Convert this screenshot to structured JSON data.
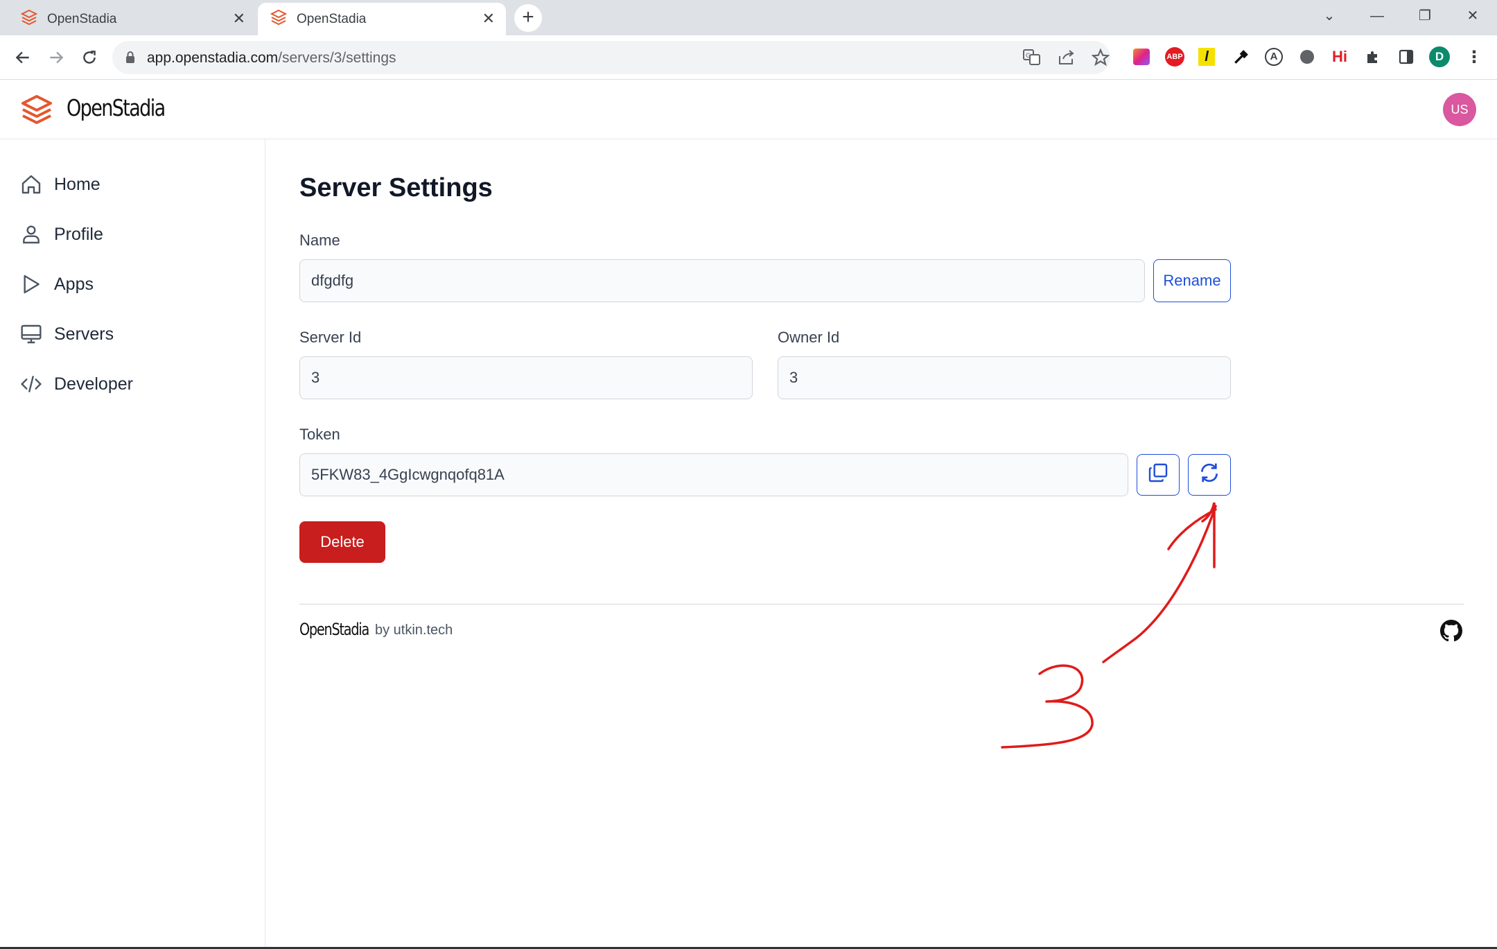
{
  "browser": {
    "tabs": [
      {
        "title": "OpenStadia",
        "active": false
      },
      {
        "title": "OpenStadia",
        "active": true
      }
    ],
    "url_host": "app.openstadia.com",
    "url_path": "/servers/3/settings",
    "profile_initial": "D",
    "ext_abp": "ABP",
    "ext_hi": "Hi"
  },
  "header": {
    "brand": "OpenStadia",
    "avatar_initials": "US"
  },
  "sidebar": {
    "items": [
      {
        "label": "Home",
        "icon": "home-icon"
      },
      {
        "label": "Profile",
        "icon": "user-icon"
      },
      {
        "label": "Apps",
        "icon": "play-icon"
      },
      {
        "label": "Servers",
        "icon": "monitor-icon"
      },
      {
        "label": "Developer",
        "icon": "code-icon"
      }
    ]
  },
  "main": {
    "title": "Server Settings",
    "name_label": "Name",
    "name_value": "dfgdfg",
    "rename_label": "Rename",
    "server_id_label": "Server Id",
    "server_id_value": "3",
    "owner_id_label": "Owner Id",
    "owner_id_value": "3",
    "token_label": "Token",
    "token_value": "5FKW83_4GgIcwgnqofq81A",
    "delete_label": "Delete"
  },
  "footer": {
    "brand": "OpenStadia",
    "by": "by utkin.tech"
  },
  "annotation": {
    "number": "3",
    "color": "#e01b1b"
  },
  "colors": {
    "accent": "#1d4ed8",
    "danger": "#c81e1e",
    "brand": "#e4572e",
    "avatar": "#d9589f"
  }
}
